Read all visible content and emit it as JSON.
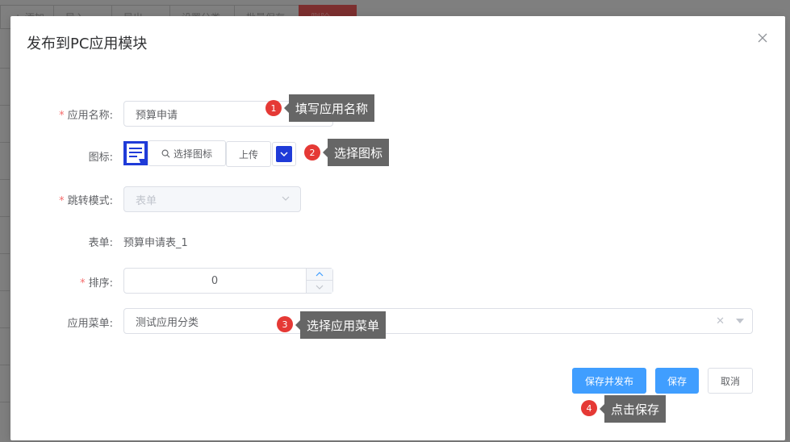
{
  "background_toolbar": {
    "buttons": [
      "+ 添加",
      "导入",
      "导出",
      "设置分类",
      "批量保存",
      "删除"
    ]
  },
  "dialog": {
    "title": "发布到PC应用模块",
    "close_icon": "close-icon",
    "required_mark": "*",
    "fields": {
      "app_name": {
        "label": "应用名称:",
        "value": "预算申请"
      },
      "icon": {
        "label": "图标:",
        "select_label": "选择图标",
        "upload_label": "上传",
        "icon_color": "#1f3bd8"
      },
      "jump_mode": {
        "label": "跳转模式:",
        "value": "表单"
      },
      "form": {
        "label": "表单:",
        "value": "预算申请表_1"
      },
      "order": {
        "label": "排序:",
        "value": "0"
      },
      "app_menu": {
        "label": "应用菜单:",
        "value": "测试应用分类"
      }
    },
    "buttons": {
      "save_publish": "保存并发布",
      "save": "保存",
      "cancel": "取消"
    }
  },
  "annotations": [
    {
      "number": "1",
      "text": "填写应用名称"
    },
    {
      "number": "2",
      "text": "选择图标"
    },
    {
      "number": "3",
      "text": "选择应用菜单"
    },
    {
      "number": "4",
      "text": "点击保存"
    }
  ],
  "colors": {
    "primary": "#409eff",
    "required": "#f56c6c",
    "marker": "#e53935",
    "tip_bg": "#666666"
  }
}
